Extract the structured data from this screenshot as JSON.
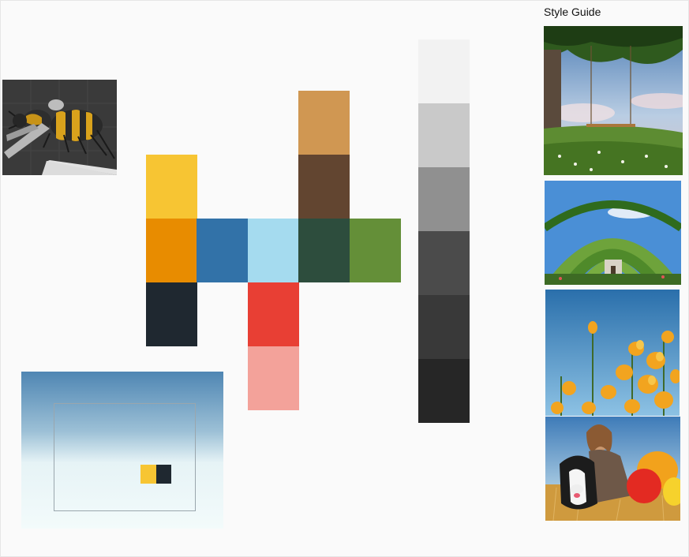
{
  "style_guide": {
    "title": "Style Guide"
  },
  "palette": {
    "yellow": "#f7c533",
    "orange": "#e88c00",
    "navy": "#1f2830",
    "blue": "#3272a8",
    "light_blue": "#a5dbef",
    "dark_green": "#2d4d3d",
    "green": "#648f38",
    "tan": "#d09752",
    "brown": "#624530",
    "red": "#e83f34",
    "pink": "#f3a29a"
  },
  "greys": [
    "#f2f2f2",
    "#c9c9c9",
    "#909090",
    "#4b4b4b",
    "#393939",
    "#262626"
  ],
  "images": {
    "bee": "bee-render-thumbnail",
    "swing": "tree-swing-photo",
    "garden": "garden-arch-photo",
    "flowers": "yellow-flowers-photo",
    "woman_dog": "woman-and-dog-photo"
  }
}
